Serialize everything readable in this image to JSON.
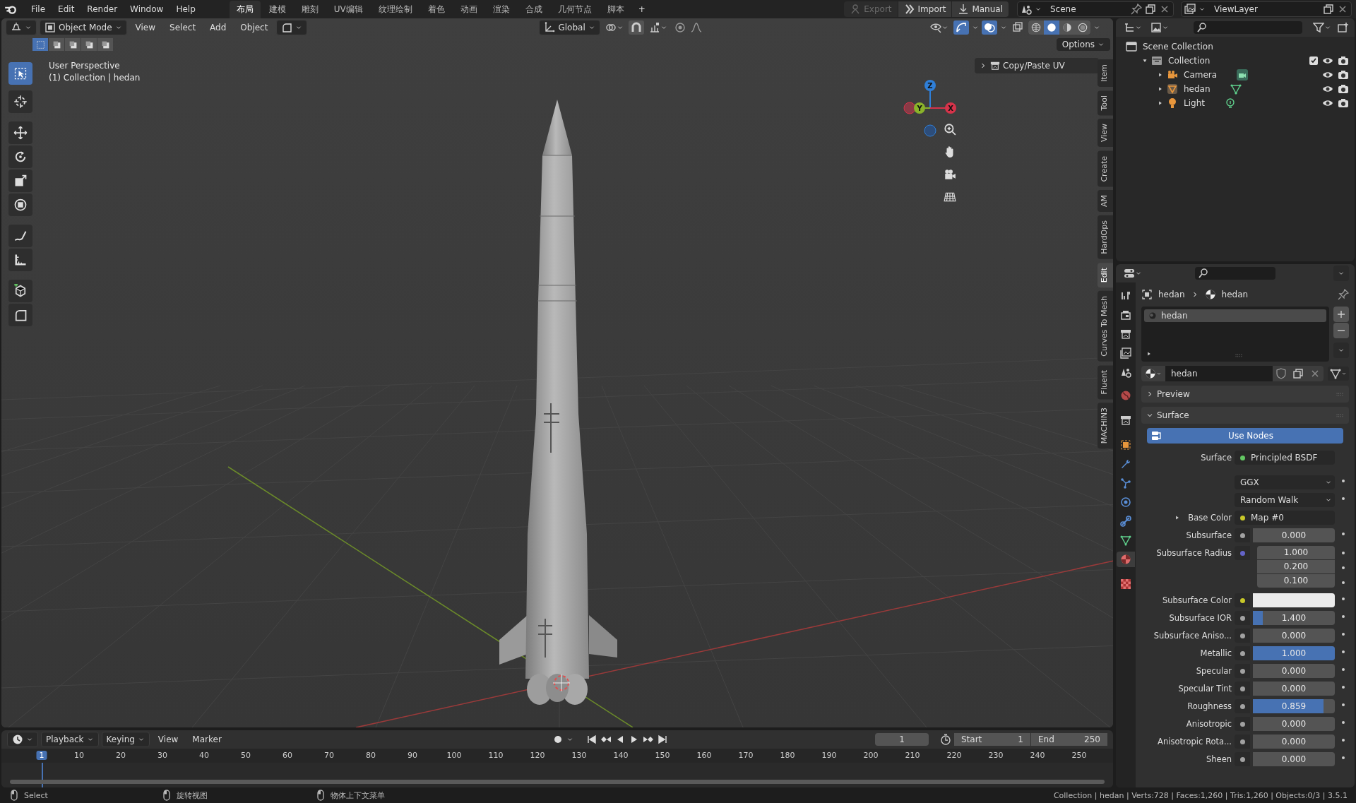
{
  "topbar": {
    "menus": [
      "File",
      "Edit",
      "Render",
      "Window",
      "Help"
    ],
    "workspaces": [
      {
        "label": "布局",
        "selected": true
      },
      {
        "label": "建模",
        "selected": false
      },
      {
        "label": "雕刻",
        "selected": false
      },
      {
        "label": "UV编辑",
        "selected": false
      },
      {
        "label": "纹理绘制",
        "selected": false
      },
      {
        "label": "着色",
        "selected": false
      },
      {
        "label": "动画",
        "selected": false
      },
      {
        "label": "渲染",
        "selected": false
      },
      {
        "label": "合成",
        "selected": false
      },
      {
        "label": "几何节点",
        "selected": false
      },
      {
        "label": "脚本",
        "selected": false
      }
    ],
    "add_tab": "+",
    "actions": [
      {
        "label": "Export",
        "disabled": true
      },
      {
        "label": "Import",
        "disabled": false
      },
      {
        "label": "Manual",
        "disabled": false
      }
    ],
    "scene": "Scene",
    "view_layer": "ViewLayer"
  },
  "viewport": {
    "mode": "Object Mode",
    "menus": [
      "View",
      "Select",
      "Add",
      "Object"
    ],
    "orientation": "Global",
    "shading": [
      {
        "selected": false
      },
      {
        "selected": true
      },
      {
        "selected": false
      },
      {
        "selected": false
      }
    ],
    "options": "Options",
    "select_modes": [
      {
        "selected": true
      },
      {
        "selected": false
      },
      {
        "selected": false
      },
      {
        "selected": false
      },
      {
        "selected": false
      }
    ],
    "tools": [
      {
        "kind": "select",
        "selected": true
      },
      {
        "kind": "cursor",
        "selected": false
      },
      {
        "kind": "move",
        "selected": false
      },
      {
        "kind": "rotate",
        "selected": false
      },
      {
        "kind": "scale",
        "selected": false
      },
      {
        "kind": "transform",
        "selected": false
      },
      {
        "kind": "annotate",
        "selected": false
      },
      {
        "kind": "measure",
        "selected": false
      },
      {
        "kind": "add_cube",
        "selected": false
      },
      {
        "kind": "corner",
        "selected": false
      }
    ],
    "info": [
      "User Perspective",
      "(1) Collection | hedan"
    ],
    "gizmo_axes": [
      "Z",
      "Y",
      "X"
    ],
    "panel": {
      "title": "Copy/Paste UV",
      "expanded": false
    },
    "side_tabs": [
      {
        "label": "Item",
        "selected": false
      },
      {
        "label": "Tool",
        "selected": false
      },
      {
        "label": "View",
        "selected": false
      },
      {
        "label": "Create",
        "selected": false
      },
      {
        "label": "AM",
        "selected": false
      },
      {
        "label": "HardOps",
        "selected": false
      },
      {
        "label": "Edit",
        "selected": true
      },
      {
        "label": "Curves To Mesh",
        "selected": false
      },
      {
        "label": "Fluent",
        "selected": false
      },
      {
        "label": "MACHIN3",
        "selected": false
      }
    ]
  },
  "outliner": {
    "tree": [
      {
        "label": "Scene Collection",
        "kind": "scene_collection",
        "children": [
          {
            "label": "Collection",
            "kind": "collection",
            "expanded": true,
            "checked": true,
            "children": [
              {
                "label": "Camera",
                "kind": "camera",
                "expanded": false
              },
              {
                "label": "hedan",
                "kind": "mesh",
                "expanded": false
              },
              {
                "label": "Light",
                "kind": "light",
                "expanded": false
              }
            ]
          }
        ]
      }
    ]
  },
  "properties": {
    "tabs": [
      {
        "kind": "tool",
        "selected": false
      },
      {
        "kind": "render",
        "selected": false
      },
      {
        "kind": "output",
        "selected": false
      },
      {
        "kind": "view_layer",
        "selected": false
      },
      {
        "kind": "scene",
        "selected": false
      },
      {
        "kind": "world",
        "selected": false
      },
      {
        "kind": "collection",
        "selected": false
      },
      {
        "kind": "object",
        "selected": false
      },
      {
        "kind": "modifier",
        "selected": false
      },
      {
        "kind": "particles",
        "selected": false
      },
      {
        "kind": "physics",
        "selected": false
      },
      {
        "kind": "constraints",
        "selected": false
      },
      {
        "kind": "data",
        "selected": false
      },
      {
        "kind": "material",
        "selected": true
      },
      {
        "kind": "texture",
        "selected": false
      }
    ],
    "breadcrumb": [
      "hedan",
      "hedan"
    ],
    "slots": [
      {
        "label": "hedan",
        "selected": true
      }
    ],
    "material": "hedan",
    "panels": [
      {
        "title": "Preview",
        "expanded": false
      },
      {
        "title": "Surface",
        "expanded": true
      }
    ],
    "use_nodes": "Use Nodes",
    "rows": [
      {
        "kind": "link",
        "label": "Surface",
        "value": "Principled BSDF",
        "color": "#63c763"
      },
      {
        "kind": "dropdown",
        "value": "GGX"
      },
      {
        "kind": "dropdown",
        "value": "Random Walk"
      },
      {
        "kind": "link",
        "label": "Base Color",
        "value": "Map #0",
        "color": "#c7c729",
        "expanded": false
      },
      {
        "kind": "slider",
        "label": "Subsurface",
        "value": "0.000",
        "level": 0,
        "color": "#a1a1a1"
      },
      {
        "kind": "vector",
        "label": "Subsurface Radius",
        "values": [
          "1.000",
          "0.200",
          "0.100"
        ],
        "color": "#6363c7"
      },
      {
        "kind": "swatch",
        "label": "Subsurface Color",
        "swatch": {
          "color": "#ebebeb"
        },
        "color": "#c7c729"
      },
      {
        "kind": "slider",
        "label": "Subsurface IOR",
        "value": "1.400",
        "level": 0.12,
        "color": "#a1a1a1"
      },
      {
        "kind": "slider",
        "label": "Subsurface Aniso...",
        "value": "0.000",
        "level": 0,
        "color": "#a1a1a1"
      },
      {
        "kind": "slider",
        "label": "Metallic",
        "value": "1.000",
        "level": 1,
        "color": "#a1a1a1"
      },
      {
        "kind": "slider",
        "label": "Specular",
        "value": "0.000",
        "level": 0,
        "color": "#a1a1a1"
      },
      {
        "kind": "slider",
        "label": "Specular Tint",
        "value": "0.000",
        "level": 0,
        "color": "#a1a1a1"
      },
      {
        "kind": "slider",
        "label": "Roughness",
        "value": "0.859",
        "level": 0.859,
        "color": "#a1a1a1"
      },
      {
        "kind": "slider",
        "label": "Anisotropic",
        "value": "0.000",
        "level": 0,
        "color": "#a1a1a1"
      },
      {
        "kind": "slider",
        "label": "Anisotropic Rota...",
        "value": "0.000",
        "level": 0,
        "color": "#a1a1a1"
      },
      {
        "kind": "slider",
        "label": "Sheen",
        "value": "0.000",
        "level": 0,
        "color": "#a1a1a1"
      }
    ]
  },
  "timeline": {
    "menus": [
      "Playback",
      "Keying",
      "View",
      "Marker"
    ],
    "current_frame": "1",
    "start_label": "Start",
    "start": "1",
    "end_label": "End",
    "end": "250",
    "ruler": [
      {
        "label": "1",
        "selected": true
      },
      {
        "label": "10",
        "selected": false
      },
      {
        "label": "20",
        "selected": false
      },
      {
        "label": "30",
        "selected": false
      },
      {
        "label": "40",
        "selected": false
      },
      {
        "label": "50",
        "selected": false
      },
      {
        "label": "60",
        "selected": false
      },
      {
        "label": "70",
        "selected": false
      },
      {
        "label": "80",
        "selected": false
      },
      {
        "label": "90",
        "selected": false
      },
      {
        "label": "100",
        "selected": false
      },
      {
        "label": "110",
        "selected": false
      },
      {
        "label": "120",
        "selected": false
      },
      {
        "label": "130",
        "selected": false
      },
      {
        "label": "140",
        "selected": false
      },
      {
        "label": "150",
        "selected": false
      },
      {
        "label": "160",
        "selected": false
      },
      {
        "label": "170",
        "selected": false
      },
      {
        "label": "180",
        "selected": false
      },
      {
        "label": "190",
        "selected": false
      },
      {
        "label": "200",
        "selected": false
      },
      {
        "label": "210",
        "selected": false
      },
      {
        "label": "220",
        "selected": false
      },
      {
        "label": "230",
        "selected": false
      },
      {
        "label": "240",
        "selected": false
      },
      {
        "label": "250",
        "selected": false
      }
    ]
  },
  "status": {
    "hints": [
      "Select",
      "旋转视图",
      "物体上下文菜单"
    ],
    "stats": "Collection | hedan | Verts:728 | Faces:1,260 | Tris:1,260 | Objects:0/3 | 3.5.1"
  }
}
